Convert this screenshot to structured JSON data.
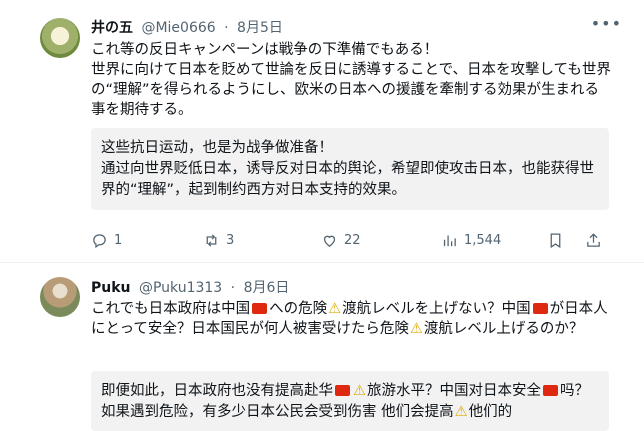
{
  "tweet1": {
    "name": "井の五",
    "handle": "@Mie0666",
    "dot": "·",
    "date": "8月5日",
    "body": "これ等の反日キャンペーンは戦争の下準備でもある！\n世界に向けて日本を貶めて世論を反日に誘導することで、日本を攻撃しても世界の“理解”を得られるようにし、欧米の日本への援護を牽制する効果が生まれる事を期待する。",
    "quote": "这些抗日运动，也是为战争做准备！\n通过向世界贬低日本，诱导反对日本的舆论，希望即使攻击日本，也能获得世界的“理解”，起到制约西方对日本支持的效果。",
    "replies": "1",
    "retweets": "3",
    "likes": "22",
    "views": "1,544"
  },
  "tweet2": {
    "name": "Puku",
    "handle": "@Puku1313",
    "dot": "·",
    "date": "8月6日",
    "body_a": "これでも日本政府は中国",
    "body_b": "への危険",
    "body_c": "渡航レベルを上げない？中国",
    "body_d": "が日本人にとって安全？日本国民が何人被害受けたら危険",
    "body_e": "渡航レベル上げるのか？",
    "quote_a": "即便如此，日本政府也没有提高赴华",
    "quote_b": "旅游水平？中国对日本安全",
    "quote_c": "吗？如果遇到危险，有多少日本公民会受到伤害 他们会提高",
    "quote_d": "他们的"
  },
  "icons": [
    "more-icon",
    "reply-icon",
    "retweet-icon",
    "like-icon",
    "views-icon",
    "bookmark-icon",
    "share-icon",
    "china-flag-icon",
    "warning-icon"
  ],
  "colors": {
    "muted": "#536471",
    "quote_bg": "#f2f2f2",
    "flag": "#de2910",
    "warning": "#e0a800"
  }
}
